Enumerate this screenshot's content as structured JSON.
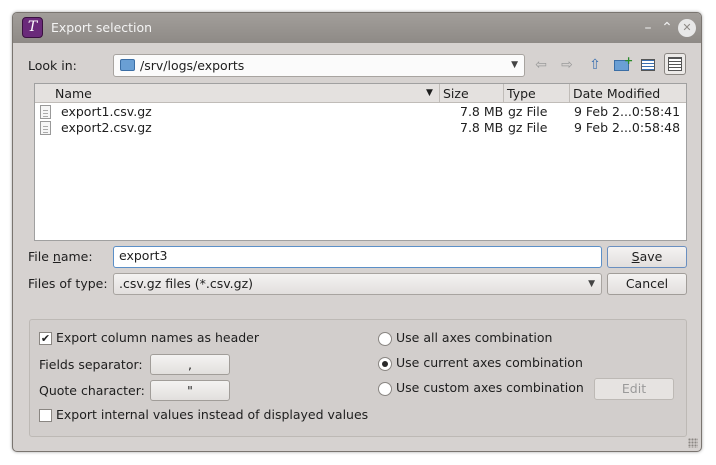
{
  "window": {
    "title": "Export selection"
  },
  "look_in": {
    "label": "Look in:",
    "path": "/srv/logs/exports"
  },
  "nav_icons": [
    "back-arrow-icon",
    "forward-arrow-icon",
    "up-folder-icon",
    "new-folder-icon",
    "list-view-icon",
    "details-view-icon"
  ],
  "file_list": {
    "columns": [
      "Name",
      "Size",
      "Type",
      "Date Modified"
    ],
    "rows": [
      {
        "name": "export1.csv.gz",
        "size": "7.8 MB",
        "type": "gz File",
        "date": "9 Feb 2...0:58:41"
      },
      {
        "name": "export2.csv.gz",
        "size": "7.8 MB",
        "type": "gz File",
        "date": "9 Feb 2...0:58:48"
      }
    ]
  },
  "file_name": {
    "label_pre": "File ",
    "label_u": "n",
    "label_post": "ame:",
    "value": "export3"
  },
  "files_of_type": {
    "label": "Files of type:",
    "value": ".csv.gz files (*.csv.gz)"
  },
  "buttons": {
    "save_u": "S",
    "save_rest": "ave",
    "cancel": "Cancel",
    "edit": "Edit"
  },
  "options": {
    "export_header": {
      "label": "Export column names as header",
      "checked": true
    },
    "fields_separator": {
      "label": "Fields separator:",
      "value": ","
    },
    "quote_character": {
      "label": "Quote character:",
      "value": "\""
    },
    "export_internal": {
      "label": "Export internal values instead of displayed values",
      "checked": false
    },
    "axes": [
      {
        "label": "Use all axes combination",
        "selected": false
      },
      {
        "label": "Use current axes combination",
        "selected": true
      },
      {
        "label": "Use custom axes combination",
        "selected": false
      }
    ]
  }
}
